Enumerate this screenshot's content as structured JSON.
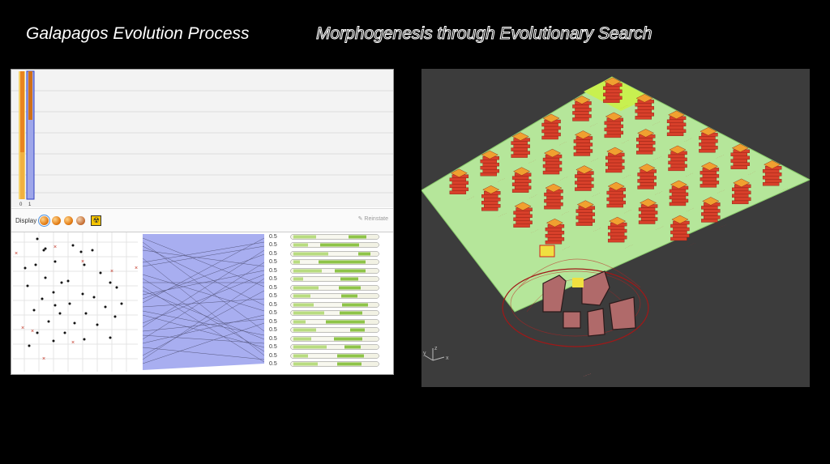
{
  "titles": {
    "left": "Galapagos Evolution Process",
    "right": "Morphogenesis through Evolutionary Search"
  },
  "galapagos": {
    "fitness_axis": {
      "ticks": [
        "0",
        "1"
      ]
    },
    "display_label": "Display",
    "reinstate_label": "Reinstate",
    "genome_values": [
      "0.5",
      "0.5",
      "0.5",
      "0.5",
      "0.5",
      "0.5",
      "0.5",
      "0.5",
      "0.5",
      "0.5",
      "0.5",
      "0.5",
      "0.5",
      "0.5",
      "0.5",
      "0.5"
    ],
    "genome_fills": [
      [
        0.28,
        0.4,
        0.22
      ],
      [
        0.18,
        0.15,
        0.48
      ],
      [
        0.43,
        0.37,
        0.15
      ],
      [
        0.08,
        0.23,
        0.58
      ],
      [
        0.35,
        0.16,
        0.38
      ],
      [
        0.12,
        0.46,
        0.22
      ],
      [
        0.31,
        0.25,
        0.27
      ],
      [
        0.21,
        0.38,
        0.2
      ],
      [
        0.25,
        0.35,
        0.32
      ],
      [
        0.38,
        0.19,
        0.28
      ],
      [
        0.15,
        0.25,
        0.48
      ],
      [
        0.28,
        0.42,
        0.18
      ],
      [
        0.22,
        0.28,
        0.35
      ],
      [
        0.41,
        0.22,
        0.2
      ],
      [
        0.18,
        0.36,
        0.33
      ],
      [
        0.3,
        0.24,
        0.3
      ]
    ]
  },
  "viewport": {
    "axis_labels": [
      "y",
      "z",
      "x"
    ]
  },
  "colors": {
    "fitness_orange": "#f0a020",
    "fitness_blue": "#9ea6ea",
    "plane_green": "#b5e69a",
    "highlight_green": "#c8f050",
    "tower_red": "#d8402a",
    "tower_top": "#f0a030",
    "genome_green": "#8ec448"
  }
}
